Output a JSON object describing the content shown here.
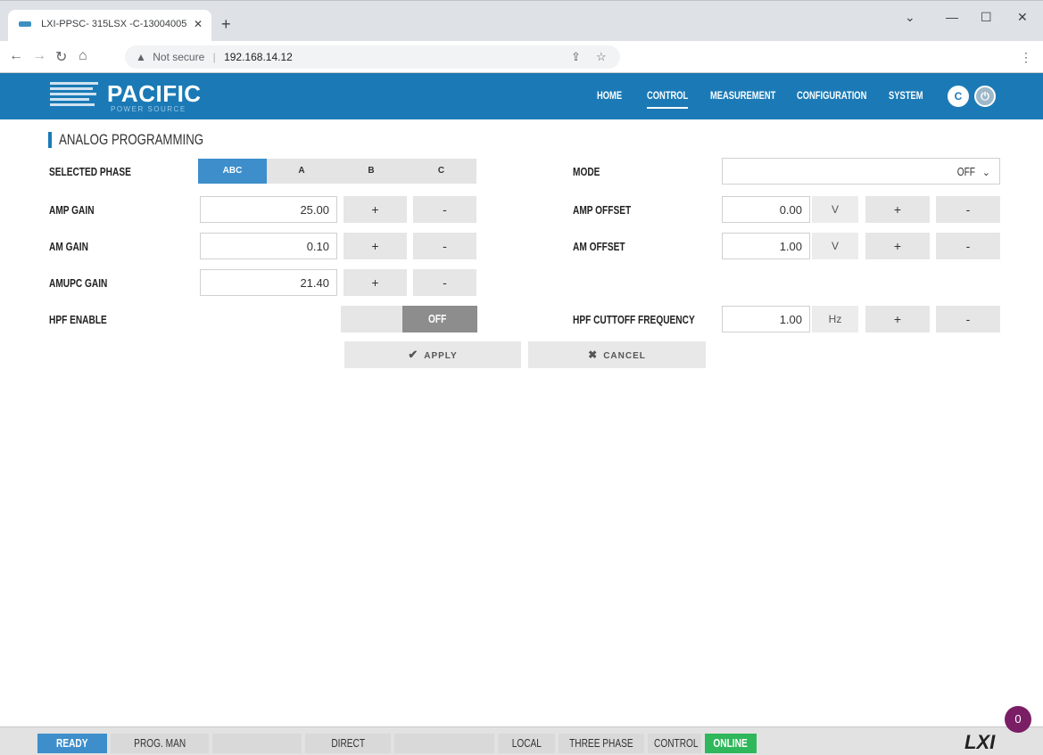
{
  "browser": {
    "tab_title": "LXI-PPSC- 315LSX -C-13004005",
    "tab_close": "✕",
    "new_tab": "+",
    "security": "Not secure",
    "url": "192.168.14.12",
    "window_controls": [
      "⌄",
      "—",
      "☐",
      "✕"
    ]
  },
  "header": {
    "logo": "PACIFIC",
    "logo_sub": "POWER SOURCE",
    "nav": [
      "HOME",
      "CONTROL",
      "MEASUREMENT",
      "CONFIGURATION",
      "SYSTEM"
    ],
    "active_nav": "CONTROL",
    "refresh_icon": "C",
    "power_icon": "⏻"
  },
  "page": {
    "title": "ANALOG PROGRAMMING",
    "selected_phase": {
      "label": "SELECTED PHASE",
      "options": [
        "ABC",
        "A",
        "B",
        "C"
      ],
      "selected": "ABC"
    },
    "mode": {
      "label": "MODE",
      "value": "OFF"
    },
    "amp_gain": {
      "label": "AMP GAIN",
      "value": "25.00"
    },
    "amp_offset": {
      "label": "AMP OFFSET",
      "value": "0.00",
      "unit": "V"
    },
    "am_gain": {
      "label": "AM GAIN",
      "value": "0.10"
    },
    "am_offset": {
      "label": "AM OFFSET",
      "value": "1.00",
      "unit": "V"
    },
    "amupc_gain": {
      "label": "AMUPC GAIN",
      "value": "21.40"
    },
    "hpf_enable": {
      "label": "HPF ENABLE",
      "value": "OFF"
    },
    "hpf_cutoff": {
      "label": "HPF CUTTOFF FREQUENCY",
      "value": "1.00",
      "unit": "Hz"
    },
    "plus": "+",
    "minus": "-",
    "apply": "APPLY",
    "cancel": "CANCEL"
  },
  "status": {
    "ready": "READY",
    "prog": "PROG. MAN",
    "direct": "DIRECT",
    "local": "LOCAL",
    "phase": "THREE PHASE",
    "control": "CONTROL",
    "online": "ONLINE",
    "lxi": "LXI",
    "badge": "0"
  },
  "colors": {
    "brand": "#1b7ab6",
    "active": "#3d8ecb",
    "online": "#2fb75b",
    "badge": "#7a1e66"
  }
}
